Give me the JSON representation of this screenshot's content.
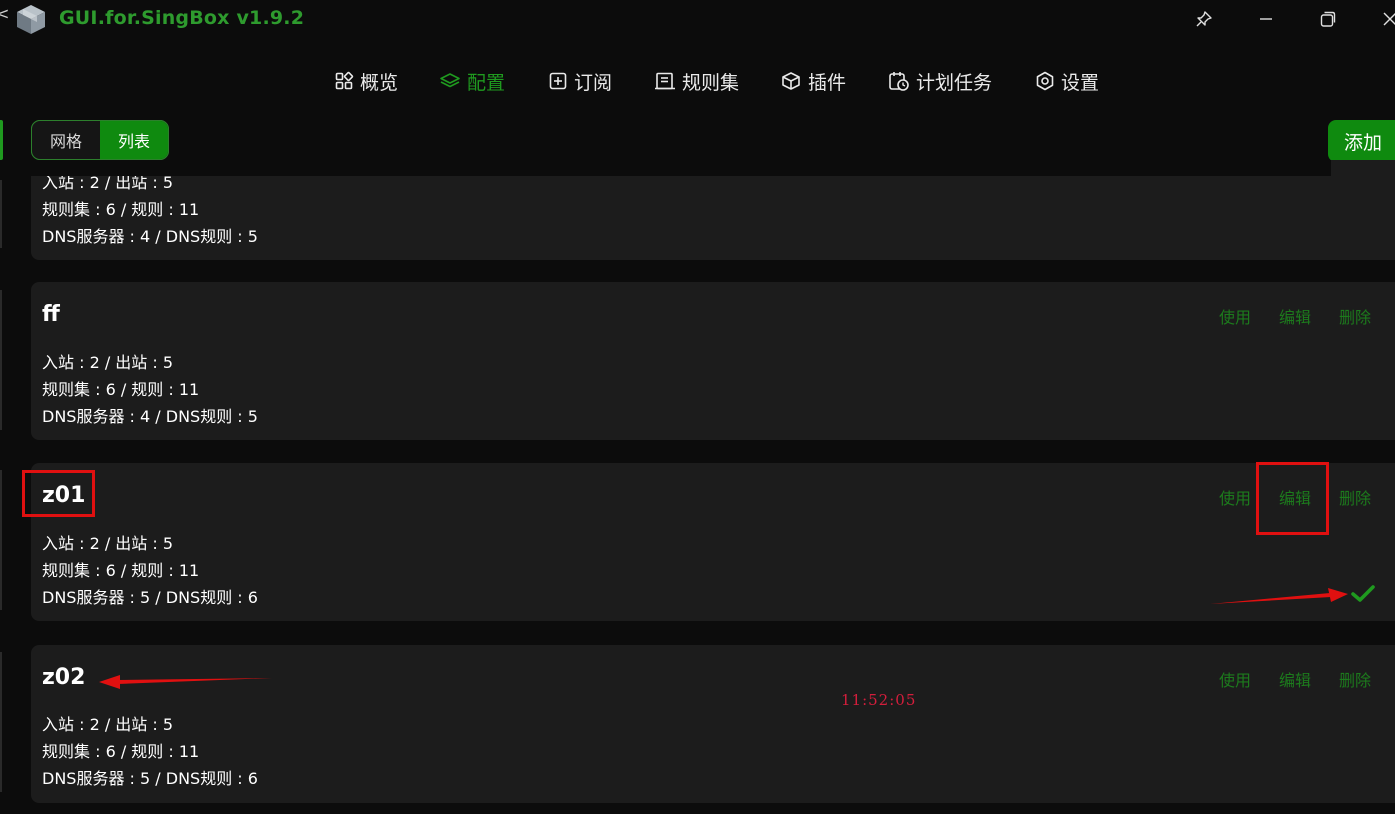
{
  "window": {
    "title": "GUI.for.SingBox v1.9.2",
    "back_glyph": "<",
    "controls": [
      "pin-icon",
      "minimize-icon",
      "restore-icon",
      "close-icon"
    ]
  },
  "nav": {
    "items": [
      {
        "label": "概览",
        "icon": "grid-icon"
      },
      {
        "label": "配置",
        "icon": "layers-icon",
        "active": true
      },
      {
        "label": "订阅",
        "icon": "square-plus-icon"
      },
      {
        "label": "规则集",
        "icon": "list-icon"
      },
      {
        "label": "插件",
        "icon": "box-icon"
      },
      {
        "label": "计划任务",
        "icon": "calendar-clock-icon"
      },
      {
        "label": "设置",
        "icon": "hexagon-gear-icon"
      }
    ]
  },
  "toolbar": {
    "view_grid": "网格",
    "view_list": "列表",
    "add_label": "添加"
  },
  "profiles": [
    {
      "name": "",
      "stats": [
        "入站 : 2 / 出站 : 5",
        "规则集 : 6 / 规则 : 11",
        "DNS服务器 : 4 / DNS规则 : 5"
      ]
    },
    {
      "name": "ff",
      "actions": {
        "use": "使用",
        "edit": "编辑",
        "delete": "删除"
      },
      "stats": [
        "入站 : 2 / 出站 : 5",
        "规则集 : 6 / 规则 : 11",
        "DNS服务器 : 4 / DNS规则 : 5"
      ]
    },
    {
      "name": "z01",
      "actions": {
        "use": "使用",
        "edit": "编辑",
        "delete": "删除"
      },
      "stats": [
        "入站 : 2 / 出站 : 5",
        "规则集 : 6 / 规则 : 11",
        "DNS服务器 : 5 / DNS规则 : 6"
      ],
      "selected": true
    },
    {
      "name": "z02",
      "actions": {
        "use": "使用",
        "edit": "编辑",
        "delete": "删除"
      },
      "stats": [
        "入站 : 2 / 出站 : 5",
        "规则集 : 6 / 规则 : 11",
        "DNS服务器 : 5 / DNS规则 : 6"
      ]
    }
  ],
  "overlay": {
    "timestamp": "11:52:05"
  },
  "colors": {
    "accent": "#0f8a0f",
    "action_text": "#1c7a1c",
    "annotation_red": "#e01010",
    "background": "#0c0c0c",
    "card": "#1c1c1c"
  }
}
